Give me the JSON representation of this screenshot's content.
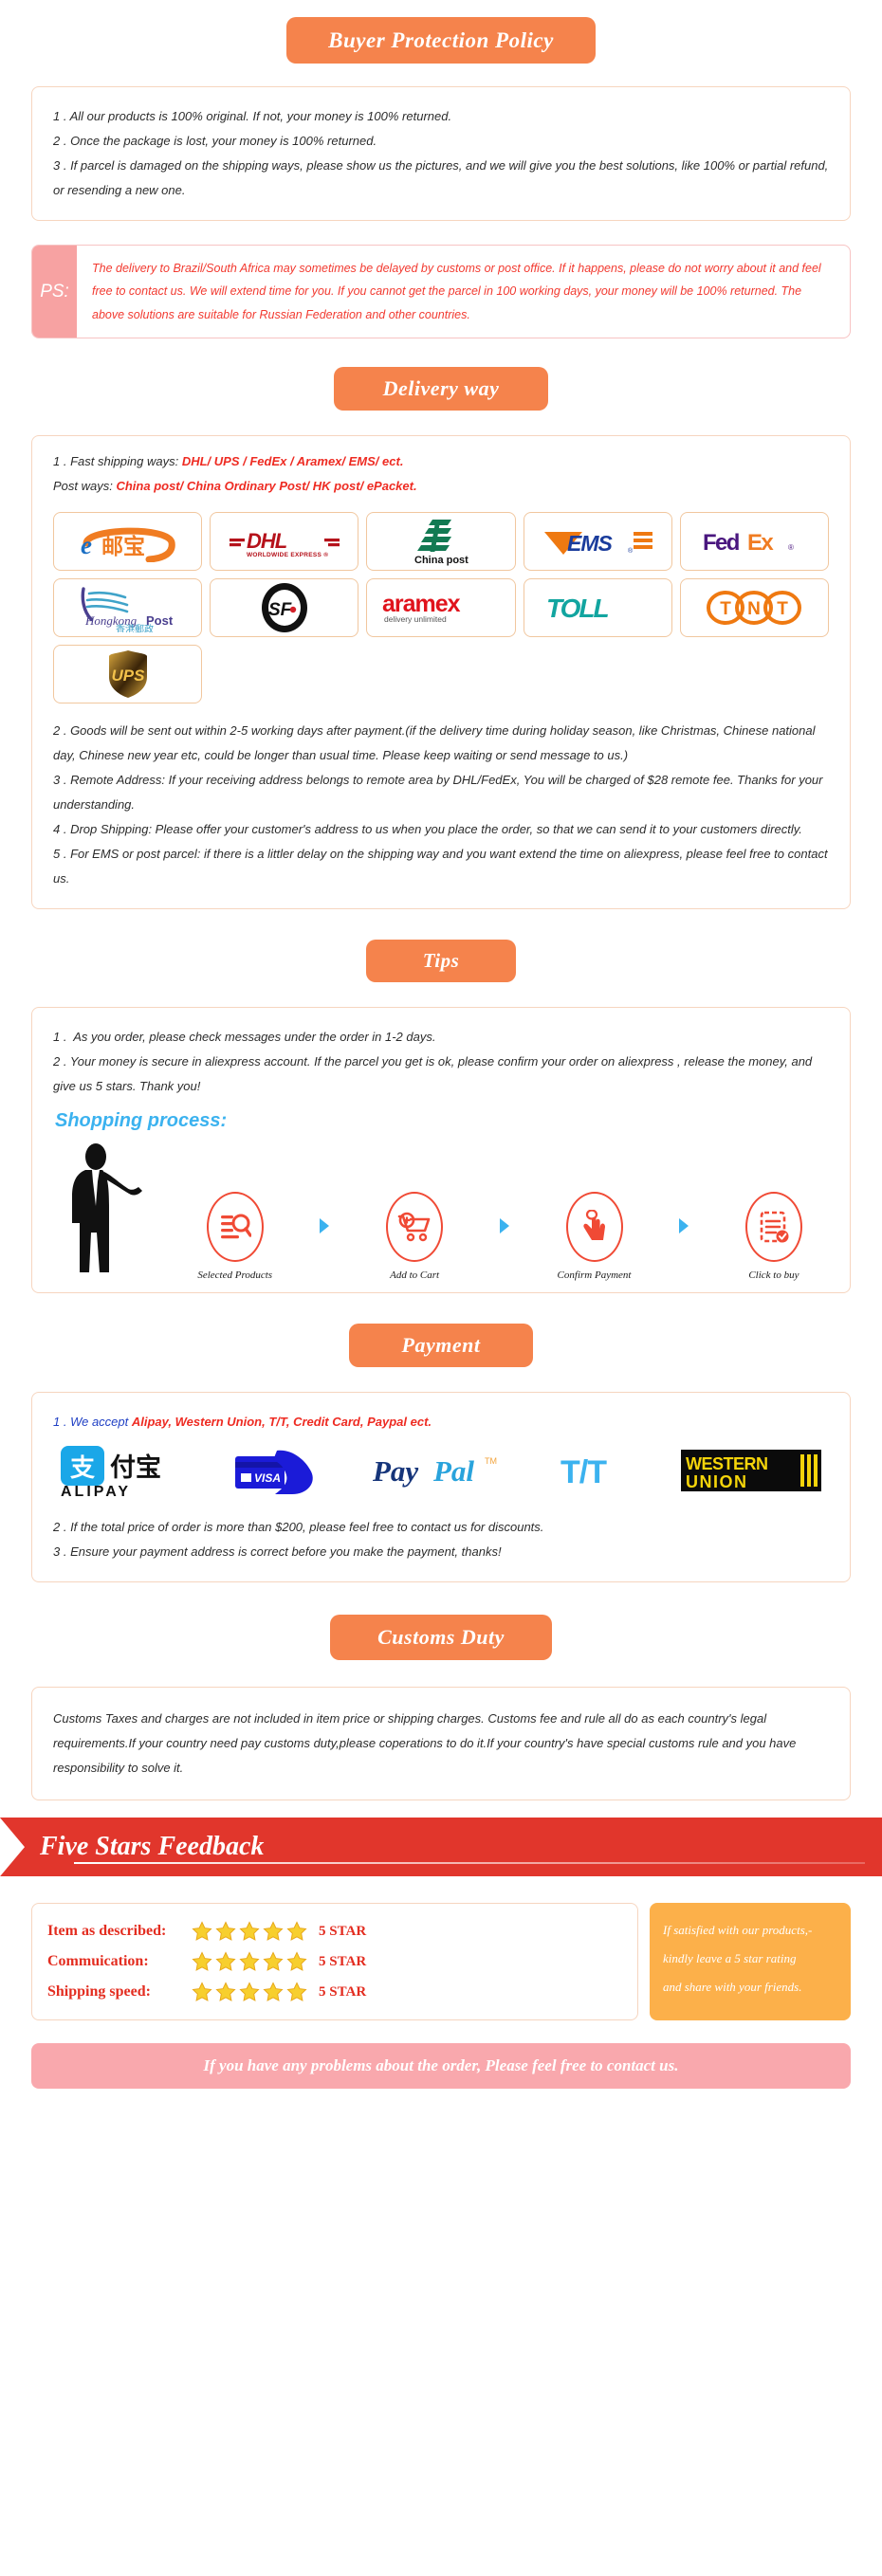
{
  "colors": {
    "orange": "#f5834c",
    "red": "#ee2b22",
    "blue": "#1f3fc4",
    "cyan": "#3bb2ef",
    "banner_red": "#e1362c",
    "ps_pink": "#f7a2a2",
    "note_amber": "#fcb04a",
    "footer_pink": "#f9a8ad"
  },
  "buyer_protection": {
    "heading": "Buyer Protection Policy",
    "lines": [
      "1 . All our products is 100% original. If not, your money is 100% returned.",
      "2 . Once the package is lost, your money is 100% returned.",
      "3 . If parcel is damaged on the shipping ways, please show us the pictures, and we will give you the best solutions, like 100% or partial refund, or resending a new one."
    ]
  },
  "ps": {
    "tag": "PS:",
    "text": "The delivery to Brazil/South Africa may sometimes be delayed by customs or post office. If it happens, please do not worry about it and feel free to contact us. We will extend time for you. If you cannot get the parcel in 100 working days, your money will be 100% returned. The above solutions are suitable for Russian Federation and other countries."
  },
  "delivery": {
    "heading": "Delivery way",
    "fast_label": "1 . Fast shipping ways: ",
    "fast_value": "DHL/ UPS / FedEx / Aramex/ EMS/ ect.",
    "post_label": "Post ways: ",
    "post_value": "China post/ China Ordinary Post/ HK post/ ePacket.",
    "carriers": [
      {
        "name": "epost-bao-logo",
        "label": "e邮宝"
      },
      {
        "name": "dhl-logo",
        "label": "DHL",
        "sub": "WORLDWIDE EXPRESS"
      },
      {
        "name": "china-post-logo",
        "label": "China post"
      },
      {
        "name": "ems-logo",
        "label": "EMS"
      },
      {
        "name": "fedex-logo",
        "label": "FedEx"
      },
      {
        "name": "hongkong-post-logo",
        "label": "Hongkong Post",
        "sub": "香港郵政"
      },
      {
        "name": "sf-express-logo",
        "label": "SF"
      },
      {
        "name": "aramex-logo",
        "label": "aramex",
        "sub": "delivery unlimited"
      },
      {
        "name": "toll-logo",
        "label": "TOLL"
      },
      {
        "name": "tnt-logo",
        "label": "TNT"
      },
      {
        "name": "ups-logo",
        "label": "UPS"
      }
    ],
    "lines": [
      "2 . Goods will be sent out within 2-5 working days after payment.(if the delivery time during holiday season, like Christmas, Chinese national day, Chinese new year etc, could be longer than usual time. Please keep waiting or send message to us.)",
      "3 . Remote Address: If your receiving address belongs to remote area by DHL/FedEx, You will be charged of $28 remote fee. Thanks for your understanding.",
      "4 . Drop Shipping: Please offer your customer's address to us when you place the order, so that we can send it to your customers directly.",
      "5 . For EMS or post parcel: if there is a littler delay on the shipping way and you want extend the time on aliexpress, please feel free to contact us."
    ]
  },
  "tips": {
    "heading": "Tips",
    "lines": [
      "1 .  As you order, please check messages under the order in 1-2 days.",
      "2 . Your money is secure in aliexpress account. If the parcel you get is ok, please confirm your order on aliexpress , release the money, and give us 5 stars. Thank you!"
    ],
    "process_title": "Shopping process:",
    "steps": [
      {
        "icon": "search-list-icon",
        "label": "Selected Products"
      },
      {
        "icon": "add-to-cart-icon",
        "label": "Add to Cart"
      },
      {
        "icon": "hand-click-icon",
        "label": "Confirm Payment"
      },
      {
        "icon": "checklist-icon",
        "label": "Click to buy"
      }
    ]
  },
  "payment": {
    "heading": "Payment",
    "accept_prefix": "1 . We accept ",
    "accept_value": "Alipay, Western Union, T/T, Credit Card, Paypal ect.",
    "methods": [
      {
        "name": "alipay-logo",
        "label": "ALIPAY"
      },
      {
        "name": "visa-credit-card-logo",
        "label": "VISA"
      },
      {
        "name": "paypal-logo",
        "label": "PayPal"
      },
      {
        "name": "tt-transfer-logo",
        "label": "T/T"
      },
      {
        "name": "western-union-logo",
        "label": "WESTERN UNION"
      }
    ],
    "lines": [
      "2 . If the total price of order is more than $200, please feel free to contact us for discounts.",
      "3 . Ensure your payment address is correct before you make the payment, thanks!"
    ]
  },
  "customs": {
    "heading": "Customs Duty",
    "text": "Customs Taxes and charges are not included in item price or shipping charges. Customs fee and rule all do as each country's legal requirements.If your country need pay customs duty,please coperations to do it.If your country's have special customs rule and you have responsibility to solve it."
  },
  "feedback": {
    "banner_title": "Five Stars Feedback",
    "rows": [
      {
        "label": "Item as described:",
        "stars": 5,
        "value": "5 STAR"
      },
      {
        "label": "Commuication:",
        "stars": 5,
        "value": "5 STAR"
      },
      {
        "label": "Shipping speed:",
        "stars": 5,
        "value": "5 STAR"
      }
    ],
    "note_lines": [
      "If satisfied with our products,-",
      "kindly leave a 5 star rating",
      "and share with your friends."
    ],
    "footer": "If you have any problems about the order, Please feel free to contact us."
  }
}
